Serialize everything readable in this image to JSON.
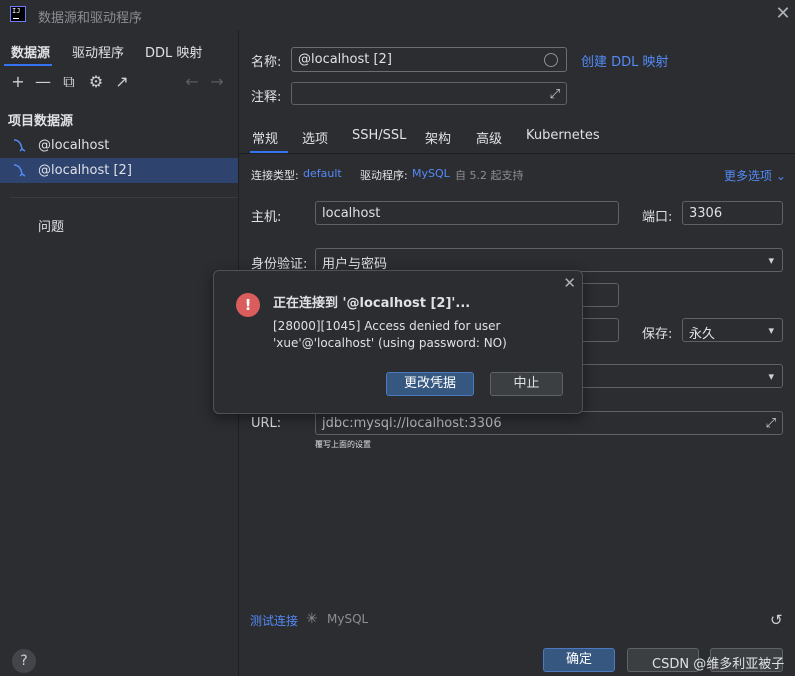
{
  "window": {
    "title": "数据源和驱动程序",
    "close_glyph": "✕",
    "logo_text": "IJ",
    "icon": "intellij-logo-icon"
  },
  "left": {
    "tabs": [
      {
        "label": "数据源",
        "active": true
      },
      {
        "label": "驱动程序",
        "active": false
      },
      {
        "label": "DDL 映射",
        "active": false
      }
    ],
    "toolbar": {
      "add_glyph": "+",
      "remove_glyph": "—",
      "copy_glyph": "⧉",
      "settings_glyph": "⚙",
      "goto_glyph": "↗",
      "back_glyph": "←",
      "forward_glyph": "→"
    },
    "section_title": "项目数据源",
    "datasources": [
      {
        "label": "@localhost",
        "selected": false,
        "icon": "mysql-dolphin-icon"
      },
      {
        "label": "@localhost [2]",
        "selected": true,
        "icon": "mysql-dolphin-icon"
      }
    ],
    "problems_label": "问题",
    "help_glyph": "?"
  },
  "form": {
    "name_label": "名称:",
    "name_value": "@localhost [2]",
    "create_ddl_link": "创建 DDL 映射",
    "comment_label": "注释:",
    "comment_value": "",
    "tabs": [
      "常规",
      "选项",
      "SSH/SSL",
      "架构",
      "高级",
      "Kubernetes"
    ],
    "connection_type_label": "连接类型:",
    "connection_type_value": "default",
    "driver_label": "驱动程序:",
    "driver_value": "MySQL",
    "driver_note": "自 5.2 起支持",
    "more_options": "更多选项",
    "host_label": "主机:",
    "host_value": "localhost",
    "port_label": "端口:",
    "port_value": "3306",
    "auth_label": "身份验证:",
    "auth_value": "用户与密码",
    "save_label": "保存:",
    "save_value": "永久",
    "url_label": "URL:",
    "url_value": "jdbc:mysql://localhost:3306",
    "url_hint": "覆写上面的设置",
    "test_connection": "测试连接",
    "test_driver": "MySQL"
  },
  "dialog": {
    "title": "正在连接到 '@localhost [2]'...",
    "message": "[28000][1045] Access denied for user 'xue'@'localhost' (using password: NO)",
    "primary_button": "更改凭据",
    "secondary_button": "中止",
    "close_glyph": "✕",
    "icon": "error-icon"
  },
  "footer": {
    "ok_button": "确定",
    "watermark": "CSDN @维多利亚被子"
  },
  "colors": {
    "accent": "#3574f0",
    "link": "#548af7",
    "error": "#db5c5c",
    "selection": "#2e436e"
  }
}
